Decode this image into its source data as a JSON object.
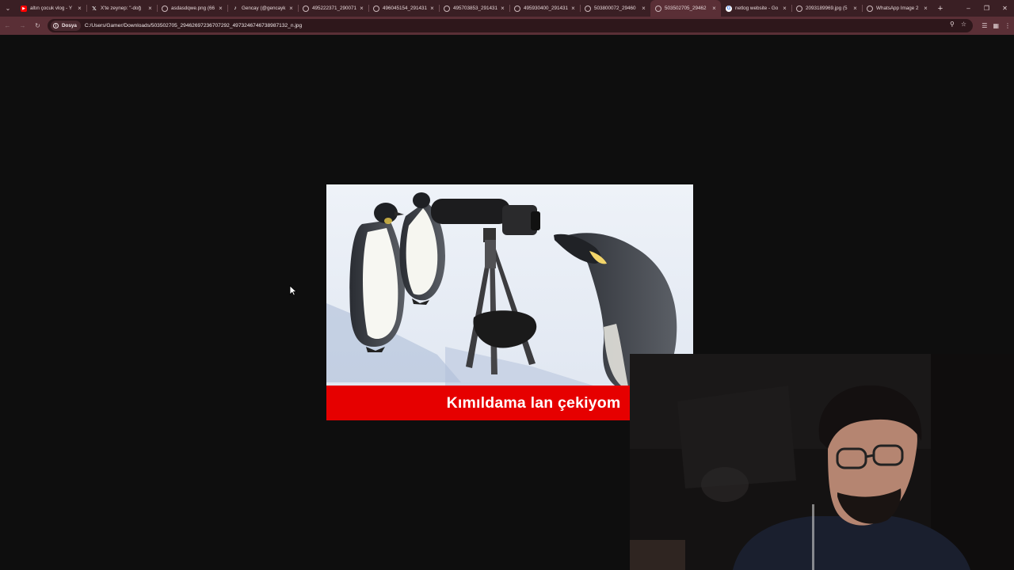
{
  "browser": {
    "tabs": [
      {
        "title": "altın çocuk vlog - Y",
        "icon": "youtube-icon",
        "active": false
      },
      {
        "title": "X'te zeynep: \"-doğ",
        "icon": "x-icon",
        "active": false
      },
      {
        "title": "asdasdqwe.png (66",
        "icon": "globe-icon",
        "active": false
      },
      {
        "title": "Gencay (@gencayk",
        "icon": "tiktok-icon",
        "active": false
      },
      {
        "title": "495222371_290071",
        "icon": "globe-icon",
        "active": false
      },
      {
        "title": "496045154_291431",
        "icon": "globe-icon",
        "active": false
      },
      {
        "title": "495703853_291431",
        "icon": "globe-icon",
        "active": false
      },
      {
        "title": "495930400_291431",
        "icon": "globe-icon",
        "active": false
      },
      {
        "title": "503800072_29460",
        "icon": "globe-icon",
        "active": false
      },
      {
        "title": "503502705_29462",
        "icon": "globe-icon",
        "active": true
      },
      {
        "title": "netlog website - Go",
        "icon": "google-icon",
        "active": false
      },
      {
        "title": "2093189969.jpg (5",
        "icon": "globe-icon",
        "active": false
      },
      {
        "title": "WhatsApp Image 2",
        "icon": "globe-icon",
        "active": false
      }
    ],
    "address": {
      "chip_label": "Dosya",
      "url": "C:/Users/Gamer/Downloads/503502705_29462697236707292_4973246746738987132_n.jpg"
    }
  },
  "image": {
    "caption": "Kımıldama lan çekiyom"
  },
  "colors": {
    "tab_strip": "#3a1f24",
    "toolbar": "#5a2f36",
    "page_background": "#0e0e0e",
    "caption_bar": "#e60000"
  }
}
